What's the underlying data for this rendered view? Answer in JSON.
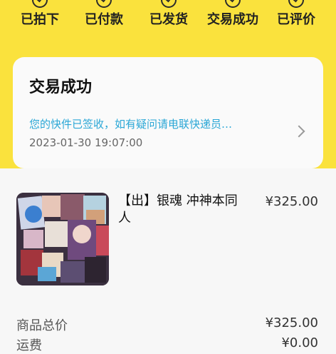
{
  "steps": [
    {
      "label": "已拍下"
    },
    {
      "label": "已付款"
    },
    {
      "label": "已发货"
    },
    {
      "label": "交易成功"
    },
    {
      "label": "已评价"
    }
  ],
  "status": {
    "title": "交易成功",
    "message": "您的快件已签收，如有疑问请电联快递员…",
    "time": "2023-01-30 19:07:00"
  },
  "product": {
    "title": "【出】银魂 冲神本同人",
    "price": "¥325.00"
  },
  "summary": [
    {
      "label": "商品总价",
      "value": "¥325.00"
    },
    {
      "label": "运费",
      "value": "¥0.00"
    }
  ],
  "colors": {
    "accent": "#fae23d",
    "link": "#2aa7d6"
  }
}
